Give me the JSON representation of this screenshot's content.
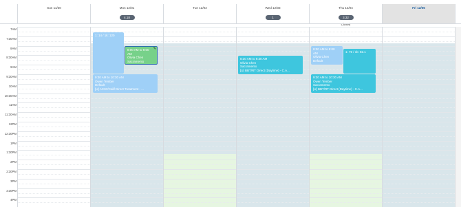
{
  "days": [
    {
      "label": "Sun 11/30",
      "badge": "",
      "note": ""
    },
    {
      "label": "Mon 12/01",
      "badge": "4.18",
      "note": ""
    },
    {
      "label": "Tue 12/02",
      "badge": "",
      "note": ""
    },
    {
      "label": "Wed 12/03",
      "badge": "1",
      "note": ""
    },
    {
      "label": "Thu 12/04",
      "badge": "3.32",
      "note": "Closed"
    },
    {
      "label": "Fri 12/05",
      "badge": "",
      "note": ""
    }
  ],
  "times": [
    "7AM",
    "7:30AM",
    "8AM",
    "8:30AM",
    "9AM",
    "9:30AM",
    "10AM",
    "10:30AM",
    "11AM",
    "11:30AM",
    "12PM",
    "12:30PM",
    "1PM",
    "1:30PM",
    "2PM",
    "2:30PM",
    "3PM",
    "3:30PM",
    "4PM"
  ],
  "events": {
    "mon_top": {
      "line1": "1: 14 / 1k: 120"
    },
    "mon_green": {
      "line1": "8:00 AM to 9:00",
      "line2": "AM",
      "line3": "Olivia Chen",
      "line4": "Sacramento"
    },
    "mon_mid": {
      "line1": "9:30 AM to 10:30 AM",
      "line2": "Owen Tember",
      "line3": "Default",
      "line4": "[U] ACS#/Calif Direct Treatment - ..."
    },
    "wed": {
      "line1": "8:30 AM to 9:30 AM",
      "line2": "Olivia Chen",
      "line3": "Sacramento",
      "line4": "[U] BBT/RT Direct (Daytime) - C.A..."
    },
    "thu_small": {
      "line1": "8:00 AM to 9:00",
      "line2": "AM",
      "line3": "Olivia Chen",
      "line4": "Default"
    },
    "thu_badge": {
      "line1": "1: 75 / 1k: 82.1"
    },
    "thu_mid": {
      "line1": "9:30 AM to 10:30 AM",
      "line2": "Owen Tember",
      "line3": "Sacramento",
      "line4": "[U] BBT/RT Direct (Daytime) - C.A..."
    }
  },
  "colors": {
    "unavailable": "#d9e6eb",
    "available": "#e6f6e1",
    "today_header": "#e3e3e3",
    "event_blue": "#9fd0f7",
    "event_green": "#77d18a",
    "event_cyan": "#3ec6de"
  }
}
